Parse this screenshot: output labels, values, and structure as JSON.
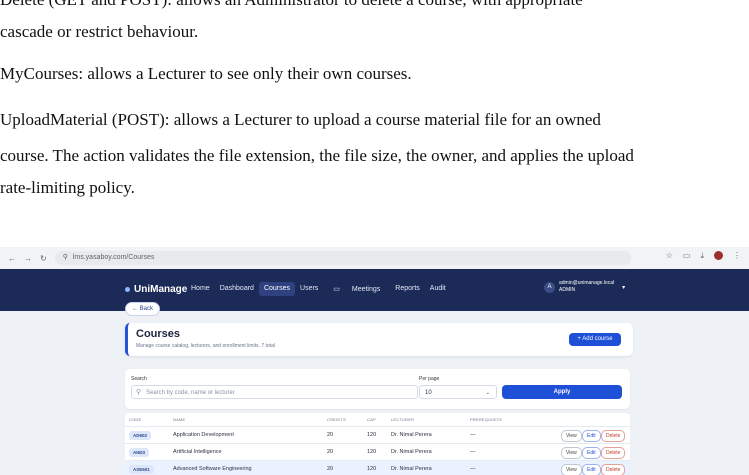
{
  "document": {
    "paragraphs": [
      "Delete (GET and POST): allows an Administrator to delete a course, with appropriate",
      "cascade or restrict behaviour.",
      "MyCourses: allows a Lecturer to see only their own courses.",
      "UploadMaterial (POST): allows a Lecturer to upload a course material file for an owned",
      "course. The action validates the file extension, the file size, the owner, and applies the upload",
      "rate-limiting policy."
    ]
  },
  "browser": {
    "url": "lms.yasaboy.com/Courses",
    "back_icon": "arrow-left-icon",
    "forward_icon": "arrow-right-icon",
    "reload_icon": "reload-icon"
  },
  "app": {
    "brand": "UniManage",
    "nav": [
      "Home",
      "Dashboard",
      "Courses",
      "Users",
      "Meetings",
      "Reports",
      "Audit"
    ],
    "active_nav": "Courses",
    "user_email": "admin@unimanage.local",
    "user_role": "ADMIN",
    "user_initial": "A"
  },
  "page": {
    "back_label": "← Back",
    "title": "Courses",
    "subtitle": "Manage course catalog, lecturers, and enrollment limits. 7 total",
    "add_button": "+ Add course"
  },
  "filters": {
    "search_label": "Search",
    "search_placeholder": "Search by code, name or lecturer",
    "per_page_label": "Per page",
    "per_page_value": "10",
    "apply_label": "Apply"
  },
  "table": {
    "columns": [
      "CODE",
      "NAME",
      "CREDITS",
      "CAP",
      "LECTURER",
      "PREREQUISITE"
    ],
    "rows": [
      {
        "code": "AD602",
        "name": "Application Development",
        "credits": "20",
        "cap": "120",
        "lecturer": "Dr. Nimal Perera",
        "prereq": "—"
      },
      {
        "code": "AI603",
        "name": "Artificial Intelligence",
        "credits": "20",
        "cap": "120",
        "lecturer": "Dr. Nimal Perera",
        "prereq": "—"
      },
      {
        "code": "ASE601",
        "name": "Advanced Software Engineering",
        "credits": "20",
        "cap": "120",
        "lecturer": "Dr. Nimal Perera",
        "prereq": "—"
      }
    ],
    "actions": {
      "view": "View",
      "edit": "Edit",
      "delete": "Delete"
    }
  }
}
